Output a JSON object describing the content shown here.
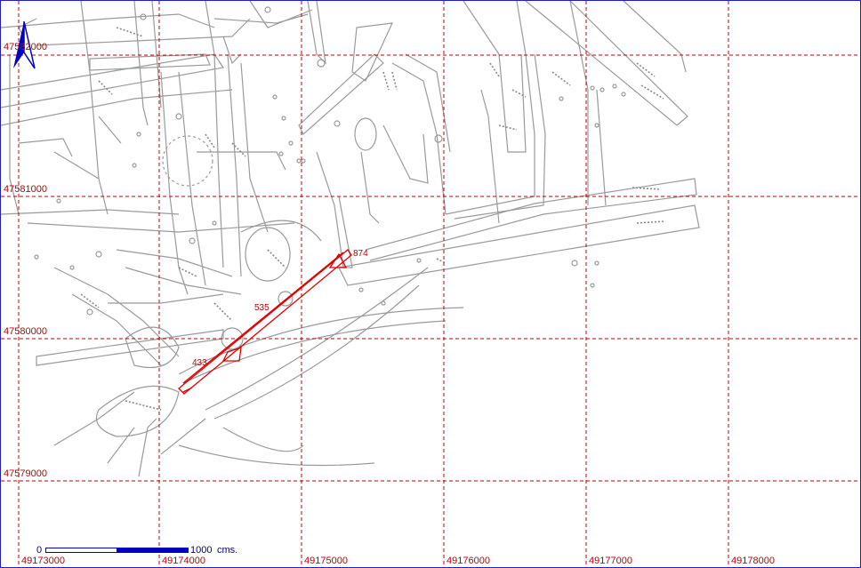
{
  "grid": {
    "x_labels": [
      "49173000",
      "49174000",
      "49175000",
      "49176000",
      "49177000",
      "49178000"
    ],
    "y_labels": [
      "47582000",
      "47581000",
      "47580000",
      "47579000"
    ]
  },
  "features": {
    "labels": [
      "874",
      "535",
      "433"
    ]
  },
  "scale_bar": {
    "start_label": "0",
    "end_label": "1000",
    "unit": "cms."
  },
  "north_arrow": {
    "icon": "north-arrow-icon"
  },
  "colors": {
    "grid": "#c00000",
    "drift_outline": "#909090",
    "highlight": "#e00000",
    "scale": "#0000c0",
    "frame": "#2020c0"
  }
}
